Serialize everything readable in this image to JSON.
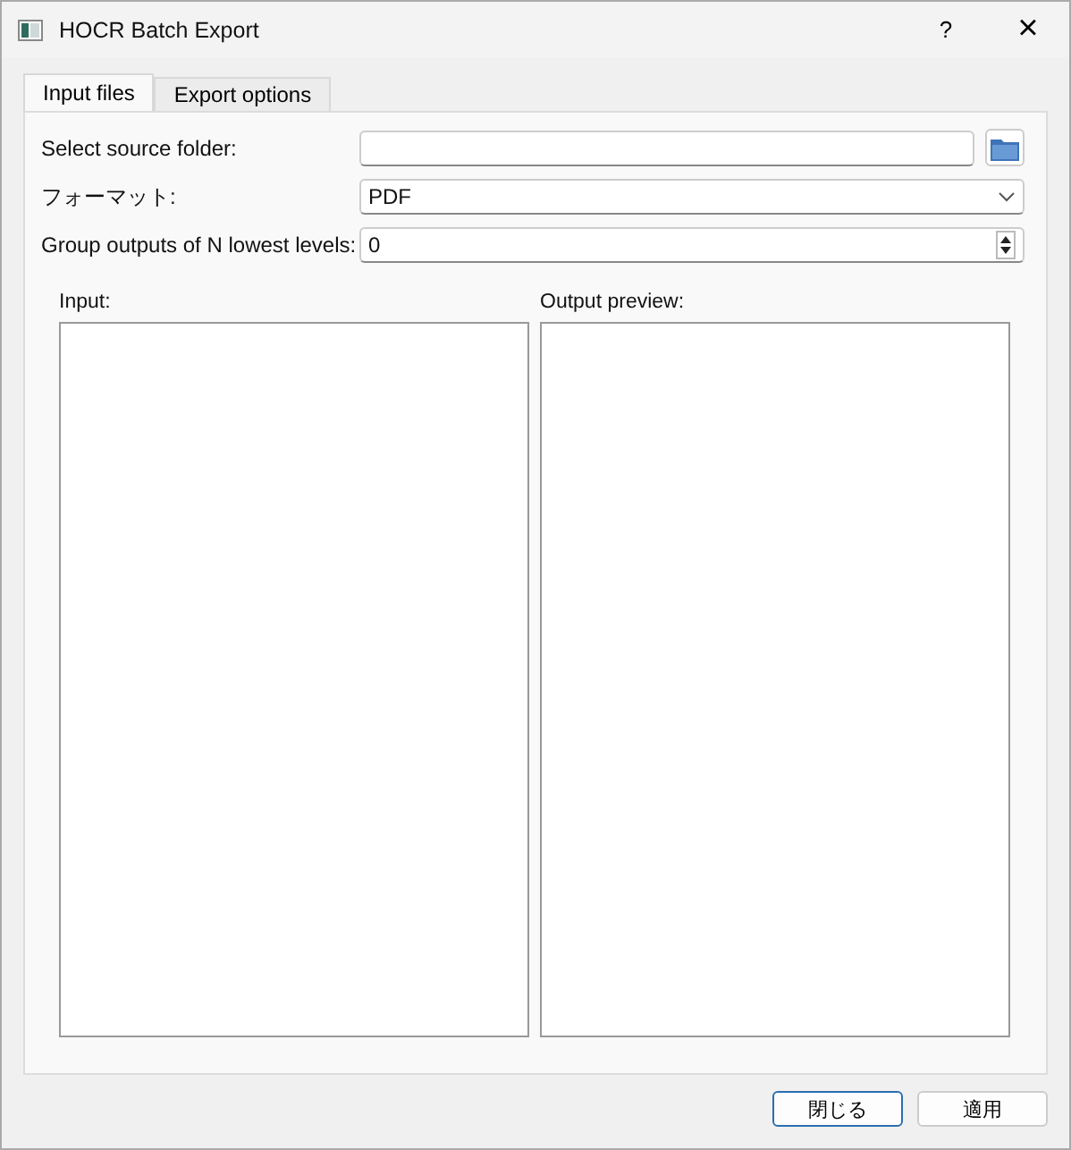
{
  "window": {
    "title": "HOCR Batch Export",
    "help": "?",
    "close": "×"
  },
  "tabs": [
    {
      "label": "Input files",
      "selected": true
    },
    {
      "label": "Export options",
      "selected": false
    }
  ],
  "form": {
    "source_folder": {
      "label": "Select source folder:"
    },
    "format": {
      "label": "フォーマット:",
      "value": "PDF"
    },
    "group": {
      "label": "Group outputs of N lowest levels:",
      "value": "0"
    }
  },
  "lists": [
    {
      "label": "Input:"
    },
    {
      "label": "Output preview:"
    }
  ],
  "buttons": [
    {
      "label": "閉じる",
      "default": true
    },
    {
      "label": "適用",
      "default": false
    }
  ]
}
